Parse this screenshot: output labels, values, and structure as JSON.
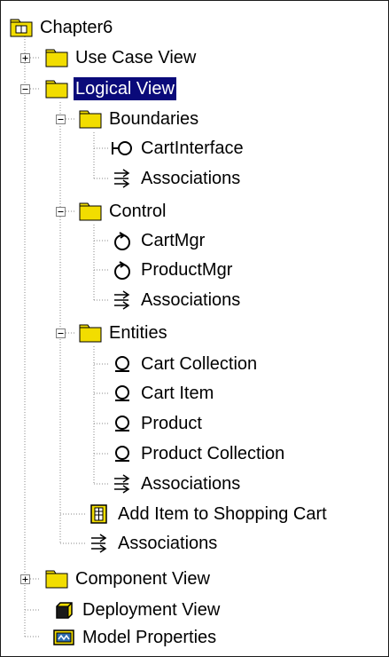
{
  "tree": {
    "root": {
      "label": "Chapter6",
      "icon": "package-icon"
    },
    "use_case_view": {
      "label": "Use Case View",
      "icon": "folder-icon",
      "expander": "plus"
    },
    "logical_view": {
      "label": "Logical View",
      "icon": "folder-icon",
      "expander": "minus",
      "selected": true
    },
    "boundaries": {
      "label": "Boundaries",
      "icon": "folder-icon",
      "expander": "minus",
      "children": [
        {
          "label": "CartInterface",
          "icon": "boundary-class-icon"
        },
        {
          "label": "Associations",
          "icon": "associations-icon"
        }
      ]
    },
    "control": {
      "label": "Control",
      "icon": "folder-icon",
      "expander": "minus",
      "children": [
        {
          "label": "CartMgr",
          "icon": "control-class-icon"
        },
        {
          "label": "ProductMgr",
          "icon": "control-class-icon"
        },
        {
          "label": "Associations",
          "icon": "associations-icon"
        }
      ]
    },
    "entities": {
      "label": "Entities",
      "icon": "folder-icon",
      "expander": "minus",
      "children": [
        {
          "label": "Cart Collection",
          "icon": "entity-class-icon"
        },
        {
          "label": "Cart Item",
          "icon": "entity-class-icon"
        },
        {
          "label": "Product",
          "icon": "entity-class-icon"
        },
        {
          "label": "Product Collection",
          "icon": "entity-class-icon"
        },
        {
          "label": "Associations",
          "icon": "associations-icon"
        }
      ]
    },
    "add_item_diagram": {
      "label": "Add Item to Shopping Cart",
      "icon": "diagram-icon"
    },
    "logical_associations": {
      "label": "Associations",
      "icon": "associations-icon"
    },
    "component_view": {
      "label": "Component View",
      "icon": "folder-icon",
      "expander": "plus"
    },
    "deployment_view": {
      "label": "Deployment View",
      "icon": "deployment-icon"
    },
    "model_properties": {
      "label": "Model Properties",
      "icon": "model-properties-icon"
    }
  },
  "colors": {
    "folder": "#f2dd00",
    "selection": "#0a0a7a",
    "tree_lines": "#8a8a8a"
  }
}
